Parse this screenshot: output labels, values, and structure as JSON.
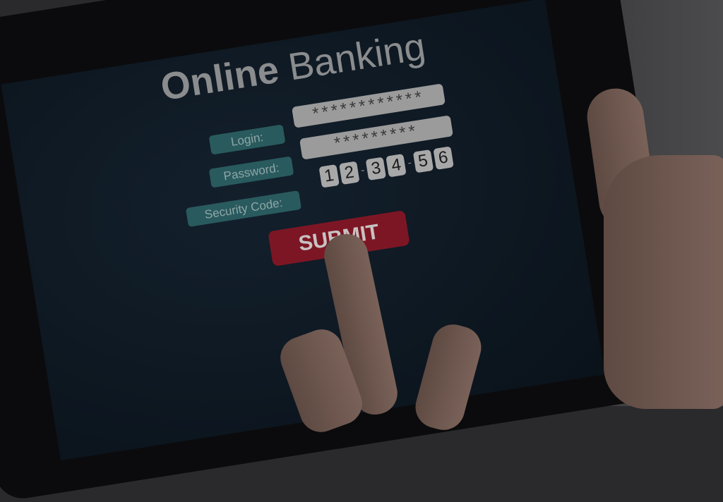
{
  "screen": {
    "title_bold": "Online",
    "title_light": "Banking",
    "login": {
      "label": "Login:",
      "value": "************"
    },
    "password": {
      "label": "Password:",
      "value": "*********"
    },
    "security_code": {
      "label": "Security Code:",
      "digits": [
        "1",
        "2",
        "3",
        "4",
        "5",
        "6"
      ],
      "separator": "-"
    },
    "submit_label": "SUBMIT"
  },
  "colors": {
    "label_bg": "#295a5e",
    "submit_bg": "#7d1624",
    "field_bg": "#9b9b9b"
  }
}
